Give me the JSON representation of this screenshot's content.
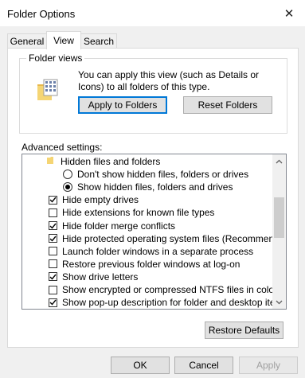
{
  "window": {
    "title": "Folder Options",
    "close_glyph": "✕"
  },
  "tabs": [
    {
      "label": "General",
      "active": false
    },
    {
      "label": "View",
      "active": true
    },
    {
      "label": "Search",
      "active": false
    }
  ],
  "folder_views": {
    "label": "Folder views",
    "description": "You can apply this view (such as Details or Icons) to all folders of this type.",
    "apply_button": "Apply to Folders",
    "reset_button": "Reset Folders"
  },
  "advanced": {
    "label": "Advanced settings:",
    "items": [
      {
        "kind": "folder",
        "label": "Hidden files and folders",
        "indent": 1
      },
      {
        "kind": "radio",
        "label": "Don't show hidden files, folders or drives",
        "checked": false,
        "indent": 2
      },
      {
        "kind": "radio",
        "label": "Show hidden files, folders and drives",
        "checked": true,
        "indent": 2
      },
      {
        "kind": "checkbox",
        "label": "Hide empty drives",
        "checked": true,
        "indent": 0
      },
      {
        "kind": "checkbox",
        "label": "Hide extensions for known file types",
        "checked": false,
        "indent": 0
      },
      {
        "kind": "checkbox",
        "label": "Hide folder merge conflicts",
        "checked": true,
        "indent": 0
      },
      {
        "kind": "checkbox",
        "label": "Hide protected operating system files (Recommended)",
        "checked": true,
        "indent": 0
      },
      {
        "kind": "checkbox",
        "label": "Launch folder windows in a separate process",
        "checked": false,
        "indent": 0
      },
      {
        "kind": "checkbox",
        "label": "Restore previous folder windows at log-on",
        "checked": false,
        "indent": 0
      },
      {
        "kind": "checkbox",
        "label": "Show drive letters",
        "checked": true,
        "indent": 0
      },
      {
        "kind": "checkbox",
        "label": "Show encrypted or compressed NTFS files in colour",
        "checked": false,
        "indent": 0
      },
      {
        "kind": "checkbox",
        "label": "Show pop-up description for folder and desktop items",
        "checked": true,
        "indent": 0
      }
    ],
    "restore_defaults": "Restore Defaults"
  },
  "footer": {
    "ok": "OK",
    "cancel": "Cancel",
    "apply": "Apply"
  },
  "colors": {
    "accent": "#0078d7",
    "folder": "#f5d574",
    "disabled_text": "#a0a0a0"
  }
}
